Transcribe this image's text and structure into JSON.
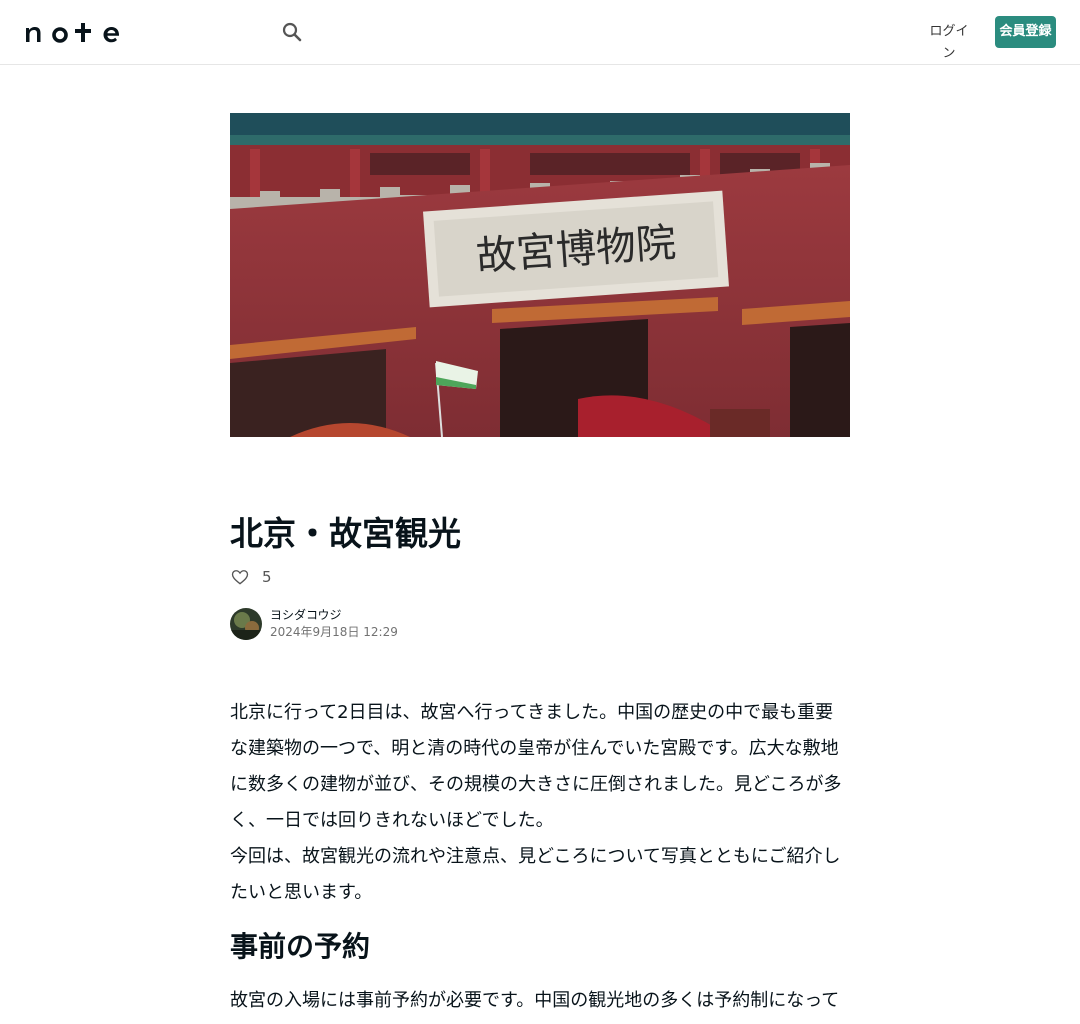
{
  "header": {
    "logo_text": "note",
    "login_label": "ログイン",
    "signup_label": "会員登録"
  },
  "hero": {
    "sign_text": "故宮博物院"
  },
  "article": {
    "title": "北京・故宮観光",
    "like_count": "5",
    "author_name": "ヨシダコウジ",
    "date": "2024年9月18日 12:29",
    "paragraphs": [
      "北京に行って2日目は、故宮へ行ってきました。中国の歴史の中で最も重要な建築物の一つで、明と清の時代の皇帝が住んでいた宮殿です。広大な敷地に数多くの建物が並び、その規模の大きさに圧倒されました。見どころが多く、一日では回りきれないほどでした。",
      "今回は、故宮観光の流れや注意点、見どころについて写真とともにご紹介したいと思います。"
    ],
    "section_heading": "事前の予約",
    "section_text": "故宮の入場には事前予約が必要です。中国の観光地の多くは予約制になっていて、当日券を購入することはできません。"
  },
  "colors": {
    "accent": "#2b8c7f",
    "text": "#08131a"
  },
  "icons": {
    "search": "search-icon",
    "heart": "heart-icon"
  }
}
